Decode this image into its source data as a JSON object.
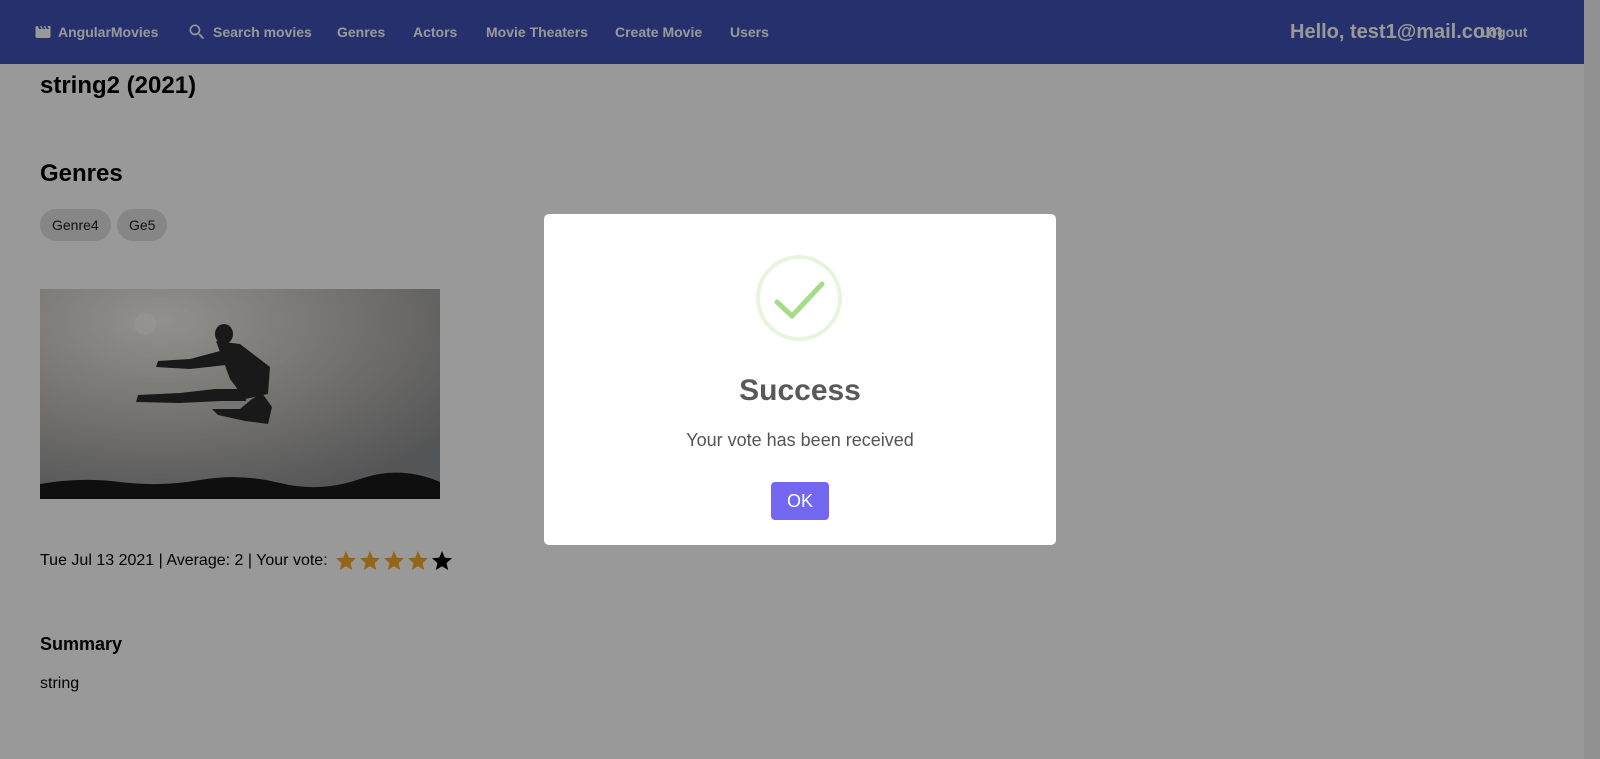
{
  "toolbar": {
    "brand": "AngularMovies",
    "search": "Search movies",
    "genres": "Genres",
    "actors": "Actors",
    "theaters": "Movie Theaters",
    "create": "Create Movie",
    "users": "Users",
    "greeting": "Hello, test1@mail.com",
    "logout": "Logout",
    "color": "#3f51b5"
  },
  "movie": {
    "title": "string2 (2021)",
    "genres_heading": "Genres",
    "genres": [
      "Genre4",
      "Ge5"
    ],
    "meta": "Tue Jul 13 2021 | Average: 2 | Your vote:",
    "vote_rating": 4,
    "vote_max": 5,
    "star_color": "#f9a825",
    "summary_heading": "Summary",
    "summary": "string"
  },
  "dialog": {
    "title": "Success",
    "text": "Your vote has been received",
    "ok": "OK",
    "icon": "success-check-icon",
    "button_color": "#7367f0"
  }
}
